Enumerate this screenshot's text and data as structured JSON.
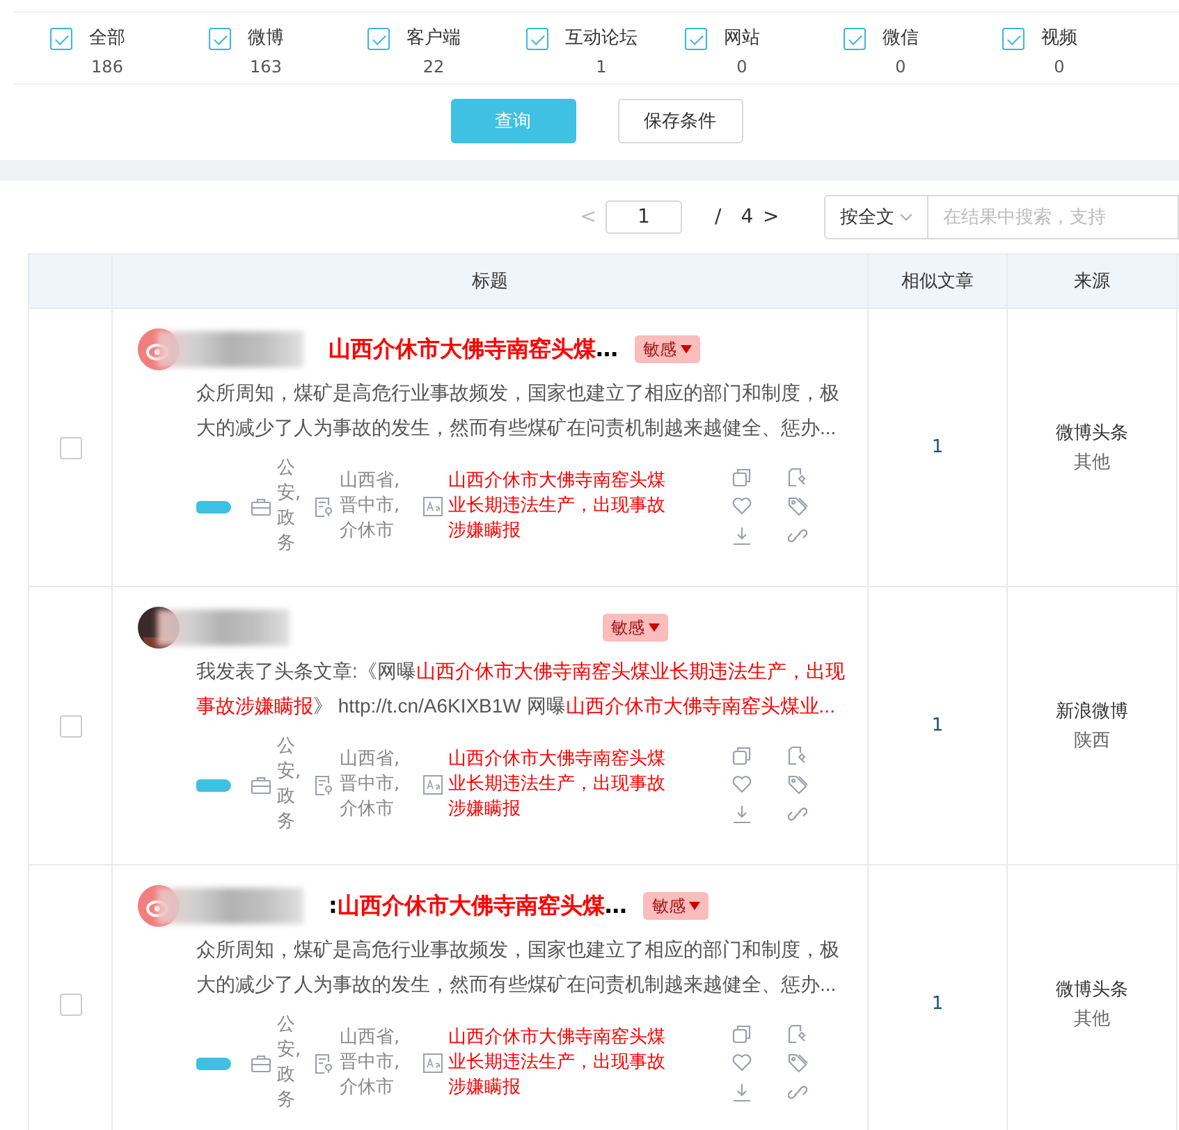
{
  "filters": [
    {
      "label": "全部",
      "count": "186",
      "checked": true
    },
    {
      "label": "微博",
      "count": "163",
      "checked": true
    },
    {
      "label": "客户端",
      "count": "22",
      "checked": true
    },
    {
      "label": "互动论坛",
      "count": "1",
      "checked": true
    },
    {
      "label": "网站",
      "count": "0",
      "checked": true
    },
    {
      "label": "微信",
      "count": "0",
      "checked": true
    },
    {
      "label": "视频",
      "count": "0",
      "checked": true
    }
  ],
  "actions": {
    "query": "查询",
    "save": "保存条件"
  },
  "pagination": {
    "prev": "<",
    "page": "1",
    "separator": "/",
    "total": "4",
    "next": ">"
  },
  "search": {
    "scope": "按全文",
    "placeholder": "在结果中搜索，支持"
  },
  "table": {
    "columns": [
      "标题",
      "相似文章",
      "来源"
    ],
    "rows": [
      {
        "checked": false,
        "avatar": {
          "kind": "weibo"
        },
        "title": [
          {
            "text": "山西介休市大佛寺南窑头煤",
            "highlight": true
          },
          {
            "text": "…",
            "highlight": false
          }
        ],
        "tag": "敏感",
        "snippet": [
          {
            "text": "众所周知，煤矿是高危行业事故频发，国家也建立了相应的部门和制度，极大的减少了人为事故的发生，然而有些煤矿在问责机制越来越健全、惩办...",
            "highlight": false
          }
        ],
        "industry": "公安,政务",
        "location": "山西省,晋中市,介休市",
        "keyword": "山西介休市大佛寺南窑头煤业长期违法生产，出现事故涉嫌瞒报",
        "similar": "1",
        "source": "微博头条",
        "region": "其他"
      },
      {
        "checked": false,
        "avatar": {
          "kind": "photo"
        },
        "title": [],
        "tag": "敏感",
        "snippet": [
          {
            "text": "我发表了头条文章:《网曝",
            "highlight": false
          },
          {
            "text": "山西介休市大佛寺南窑头煤业长期违法生产，出现事故涉嫌瞒报",
            "highlight": true
          },
          {
            "text": "》 http://t.cn/A6KIXB1W  网曝",
            "highlight": false
          },
          {
            "text": "山西介休市大佛寺南窑头煤业...",
            "highlight": true
          }
        ],
        "industry": "公安,政务",
        "location": "山西省,晋中市,介休市",
        "keyword": "山西介休市大佛寺南窑头煤业长期违法生产，出现事故涉嫌瞒报",
        "similar": "1",
        "source": "新浪微博",
        "region": "陕西"
      },
      {
        "checked": false,
        "avatar": {
          "kind": "weibo"
        },
        "title": [
          {
            "text": ":",
            "highlight": false
          },
          {
            "text": "山西介休市大佛寺南窑头煤",
            "highlight": true
          },
          {
            "text": "…",
            "highlight": false
          }
        ],
        "tag": "敏感",
        "snippet": [
          {
            "text": "众所周知，煤矿是高危行业事故频发，国家也建立了相应的部门和制度，极大的减少了人为事故的发生，然而有些煤矿在问责机制越来越健全、惩办...",
            "highlight": false
          }
        ],
        "industry": "公安,政务",
        "location": "山西省,晋中市,介休市",
        "keyword": "山西介休市大佛寺南窑头煤业长期违法生产，出现事故涉嫌瞒报",
        "similar": "1",
        "source": "微博头条",
        "region": "其他"
      }
    ]
  }
}
